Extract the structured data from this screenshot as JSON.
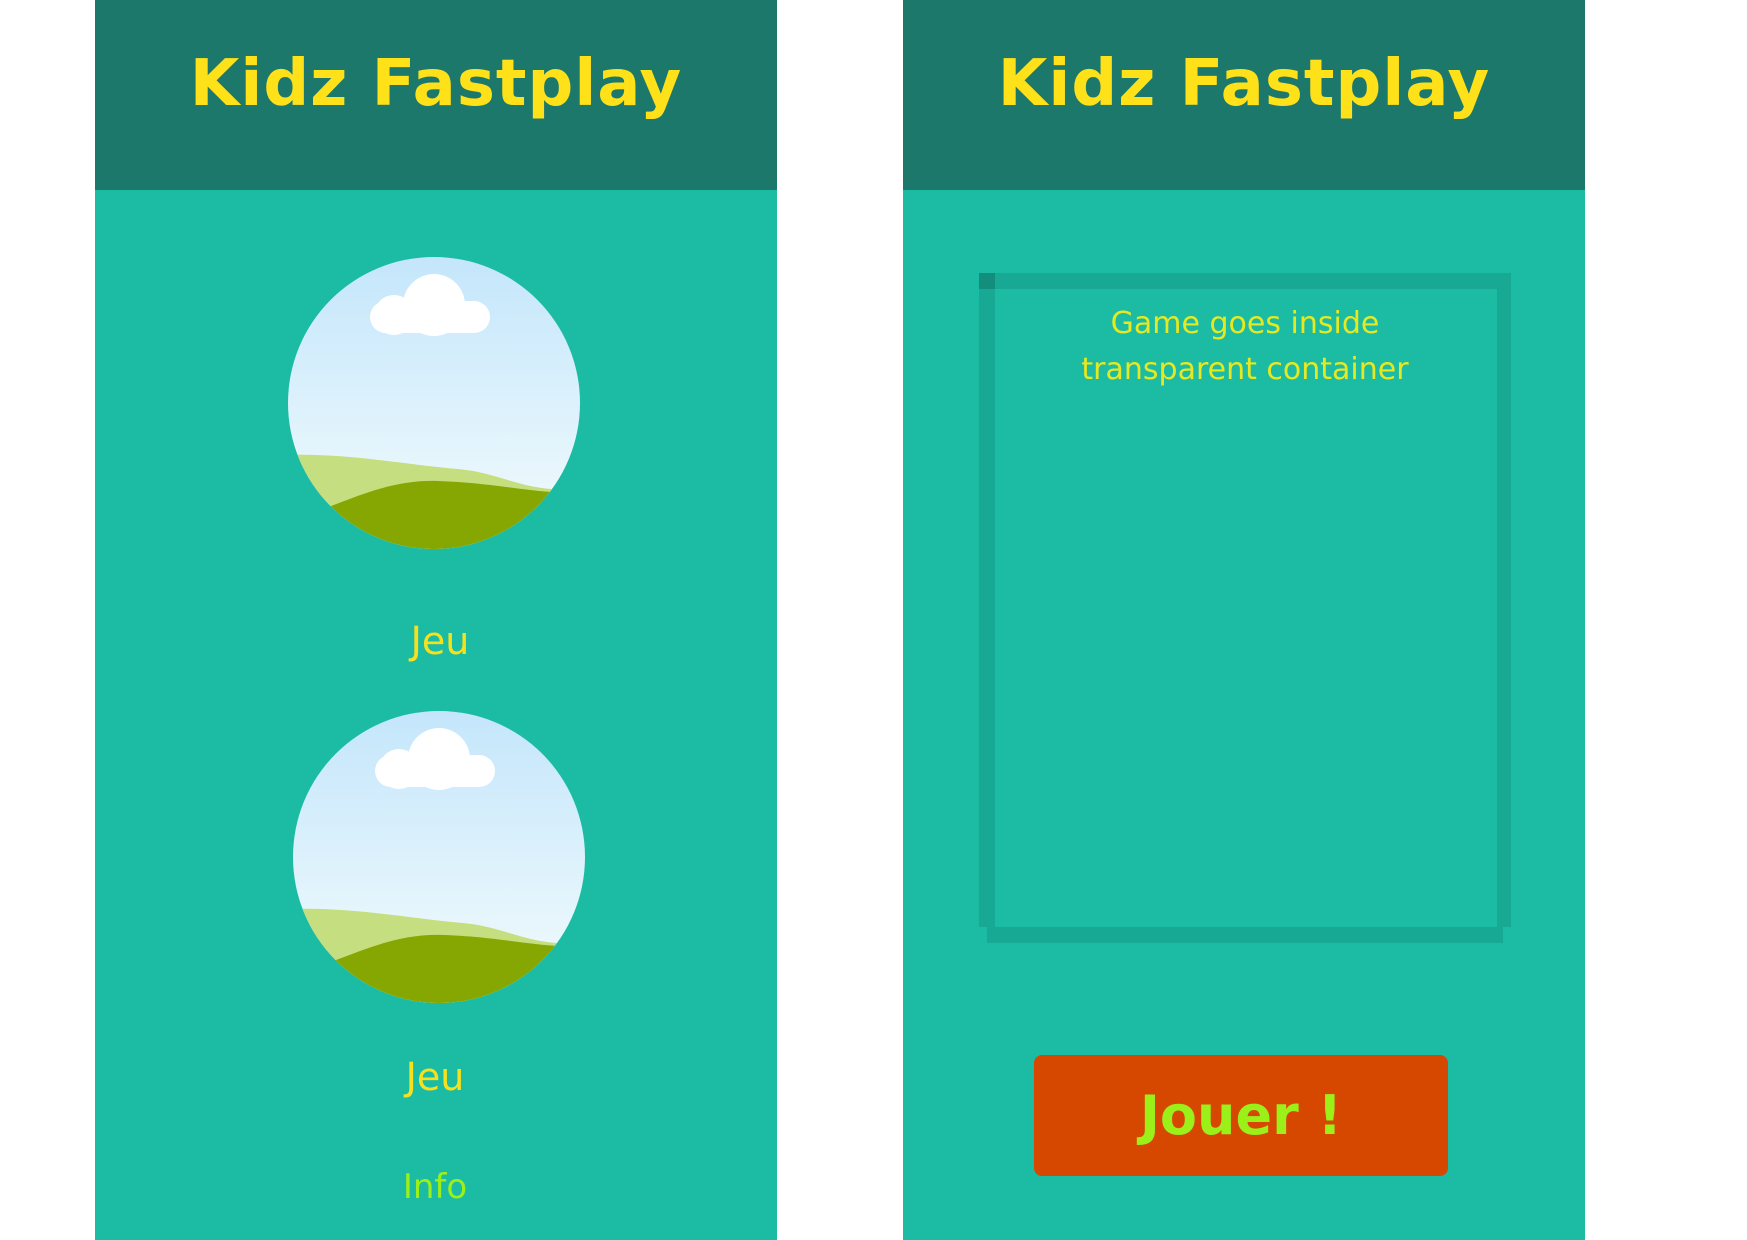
{
  "app": {
    "title": "Kidz Fastplay"
  },
  "list_screen": {
    "games": [
      {
        "label": "Jeu",
        "thumbnail": "landscape-thumbnail"
      },
      {
        "label": "Jeu",
        "thumbnail": "landscape-thumbnail"
      }
    ],
    "info_label": "Info"
  },
  "game_screen": {
    "container_text_line1": "Game goes inside",
    "container_text_line2": "transparent container",
    "play_label": "Jouer !"
  },
  "colors": {
    "header": "#1d786c",
    "background": "#1bbca3",
    "title": "#ffe11a",
    "game_label": "#f7e11d",
    "info_link": "#9bf01a",
    "play_button": "#d64700",
    "play_button_text": "#9bf01a"
  }
}
